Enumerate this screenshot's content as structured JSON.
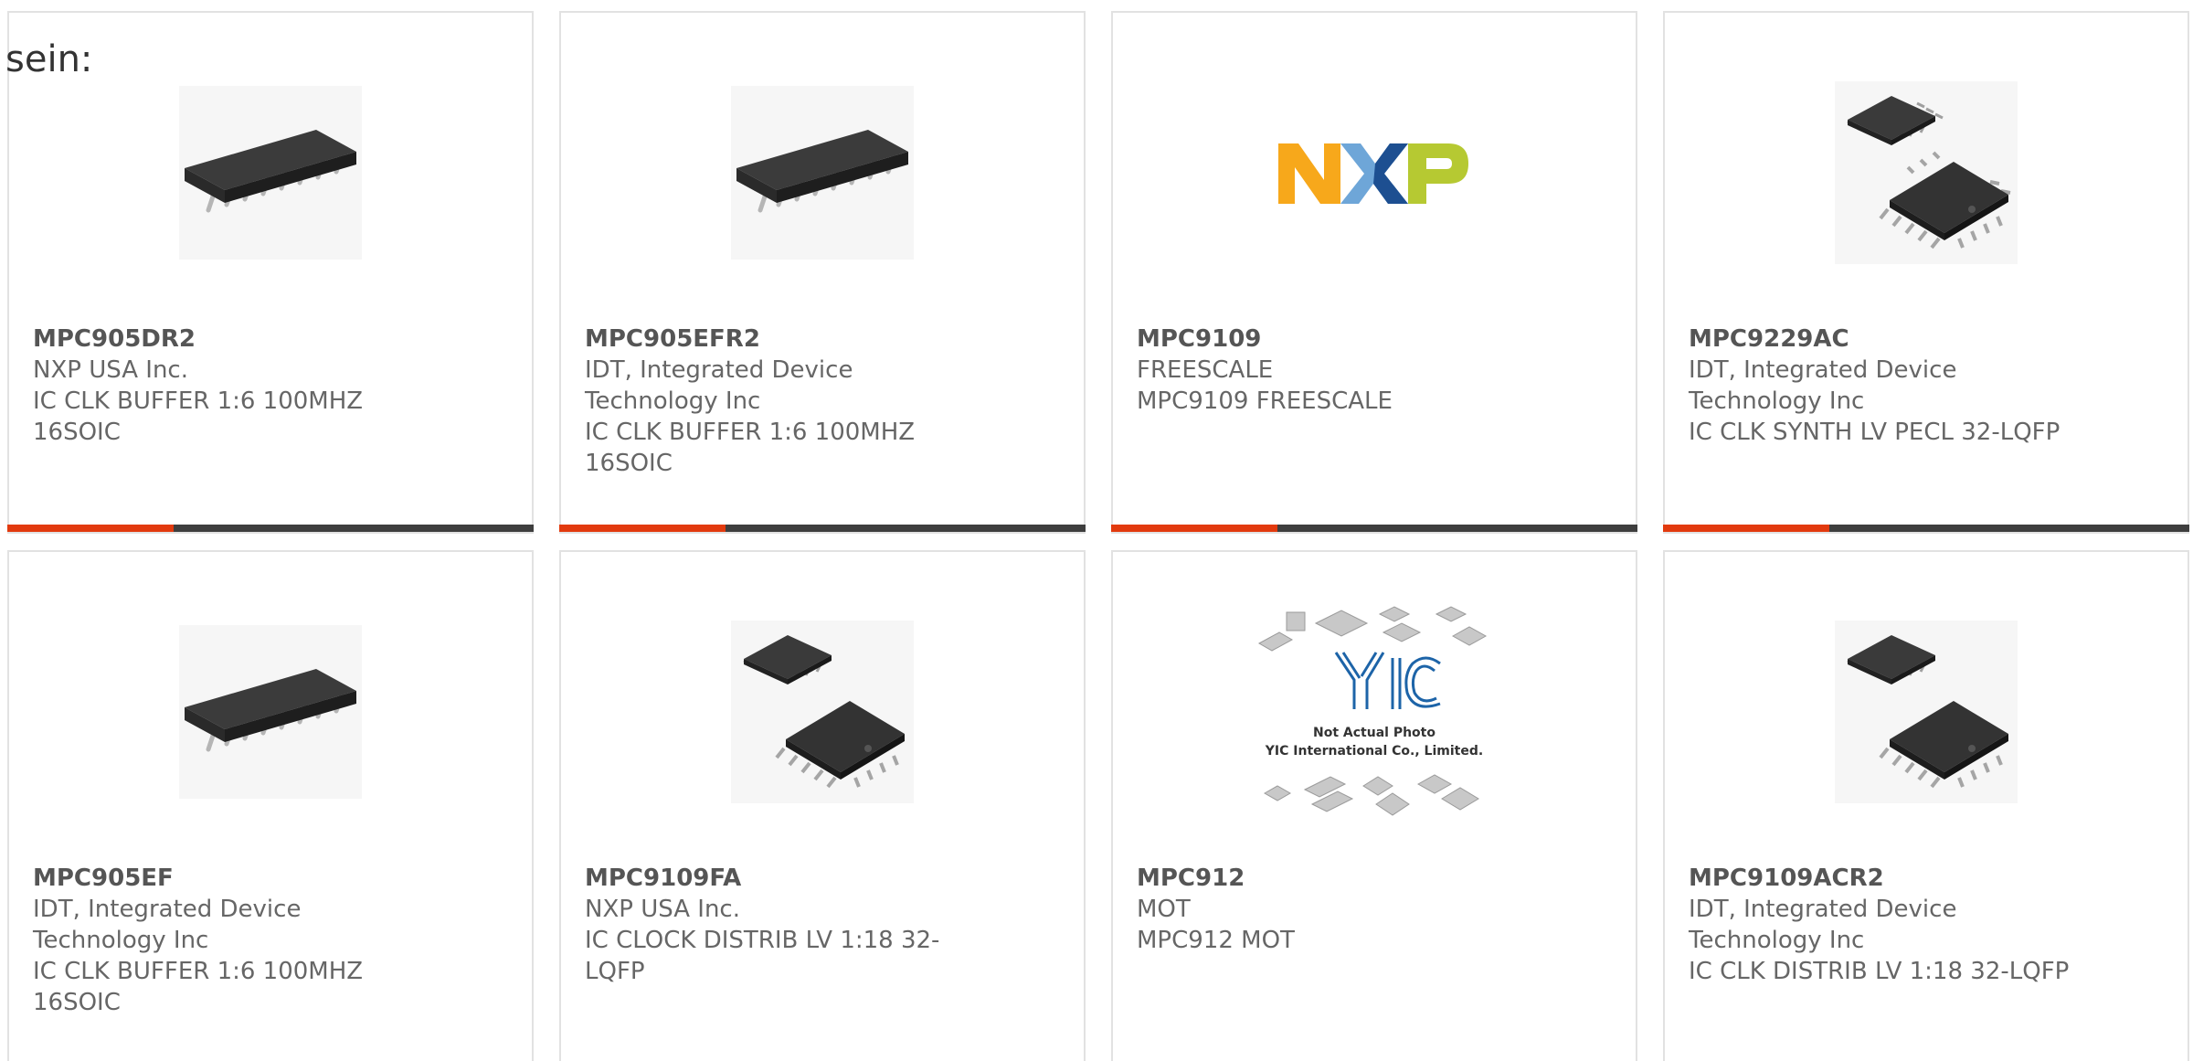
{
  "prefix": "sein:",
  "colors": {
    "accent": "#e23a0e",
    "bar": "#3e3e3e",
    "text": "#666666",
    "border": "#e2e2e2"
  },
  "products": [
    {
      "part": "MPC905DR2",
      "manufacturer": "NXP USA Inc.",
      "description": "IC CLK BUFFER 1:6 100MHZ 16SOIC",
      "image": "soic-chip-image"
    },
    {
      "part": "MPC905EFR2",
      "manufacturer": "IDT, Integrated Device Technology Inc",
      "description": "IC CLK BUFFER 1:6 100MHZ 16SOIC",
      "image": "soic-chip-image"
    },
    {
      "part": "MPC9109",
      "manufacturer": "FREESCALE",
      "description": "MPC9109 FREESCALE",
      "image": "nxp-logo-image",
      "logo_text": "NXP"
    },
    {
      "part": "MPC9229AC",
      "manufacturer": "IDT, Integrated Device Technology Inc",
      "description": "IC CLK SYNTH LV PECL 32-LQFP",
      "image": "lqfp-chip-image"
    },
    {
      "part": "MPC905EF",
      "manufacturer": "IDT, Integrated Device Technology Inc",
      "description": "IC CLK BUFFER 1:6 100MHZ 16SOIC",
      "image": "soic-chip-image"
    },
    {
      "part": "MPC9109FA",
      "manufacturer": "NXP USA Inc.",
      "description": "IC CLOCK DISTRIB LV 1:18 32-LQFP",
      "image": "lqfp-chip-image"
    },
    {
      "part": "MPC912",
      "manufacturer": "MOT",
      "description": "MPC912 MOT",
      "image": "placeholder-image",
      "placeholder_caption_1": "Not Actual Photo",
      "placeholder_caption_2": "YIC International Co., Limited."
    },
    {
      "part": "MPC9109ACR2",
      "manufacturer": "IDT, Integrated Device Technology Inc",
      "description": "IC CLK DISTRIB LV 1:18 32-LQFP",
      "image": "lqfp-chip-image"
    }
  ]
}
